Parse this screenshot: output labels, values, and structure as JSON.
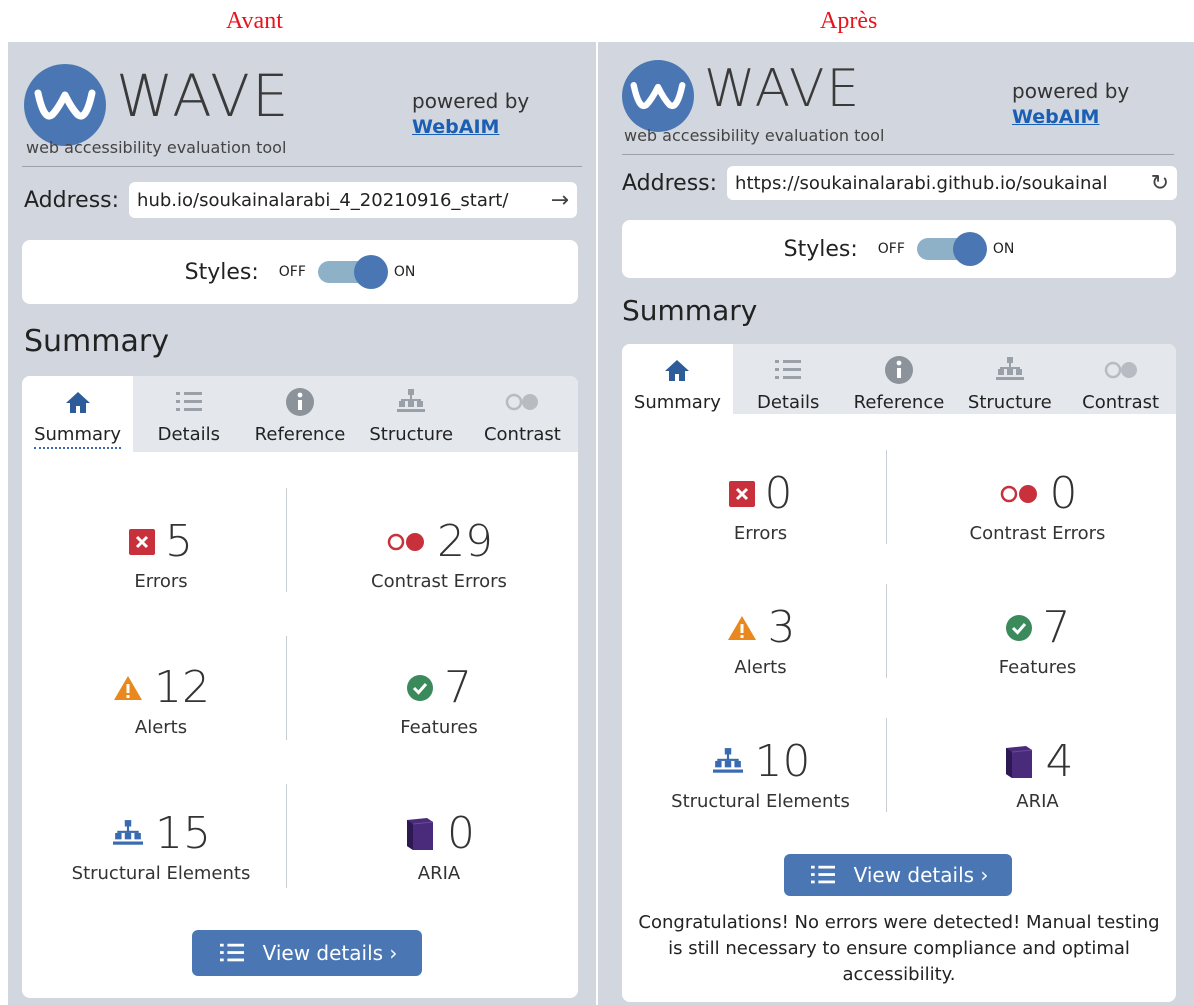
{
  "captions": {
    "before": "Avant",
    "after": "Après"
  },
  "logo": {
    "word": "WAVE",
    "tagline": "web accessibility evaluation tool",
    "powered_by": "powered by",
    "webaim": "WebAIM"
  },
  "address_label": "Address:",
  "styles": {
    "label": "Styles:",
    "off": "OFF",
    "on": "ON"
  },
  "summary_title": "Summary",
  "tabs": [
    "Summary",
    "Details",
    "Reference",
    "Structure",
    "Contrast"
  ],
  "labels": {
    "errors": "Errors",
    "contrast_errors": "Contrast Errors",
    "alerts": "Alerts",
    "features": "Features",
    "structural": "Structural Elements",
    "aria": "ARIA"
  },
  "view_details": "View details ›",
  "colors": {
    "accent": "#4a77b4",
    "error": "#c8313b",
    "alert": "#e8881e",
    "feature": "#3a8a5c",
    "aria": "#4a2a7a",
    "caption": "#e8141b"
  },
  "before": {
    "address": "hub.io/soukainalarabi_4_20210916_start/",
    "address_icon": "arrow-right-icon",
    "counts": {
      "errors": "5",
      "contrast_errors": "29",
      "alerts": "12",
      "features": "7",
      "structural": "15",
      "aria": "0"
    }
  },
  "after": {
    "address": "https://soukainalarabi.github.io/soukainal",
    "address_icon": "reload-icon",
    "counts": {
      "errors": "0",
      "contrast_errors": "0",
      "alerts": "3",
      "features": "7",
      "structural": "10",
      "aria": "4"
    },
    "congrats": "Congratulations! No errors were detected! Manual testing is still necessary to ensure compliance and optimal accessibility."
  }
}
